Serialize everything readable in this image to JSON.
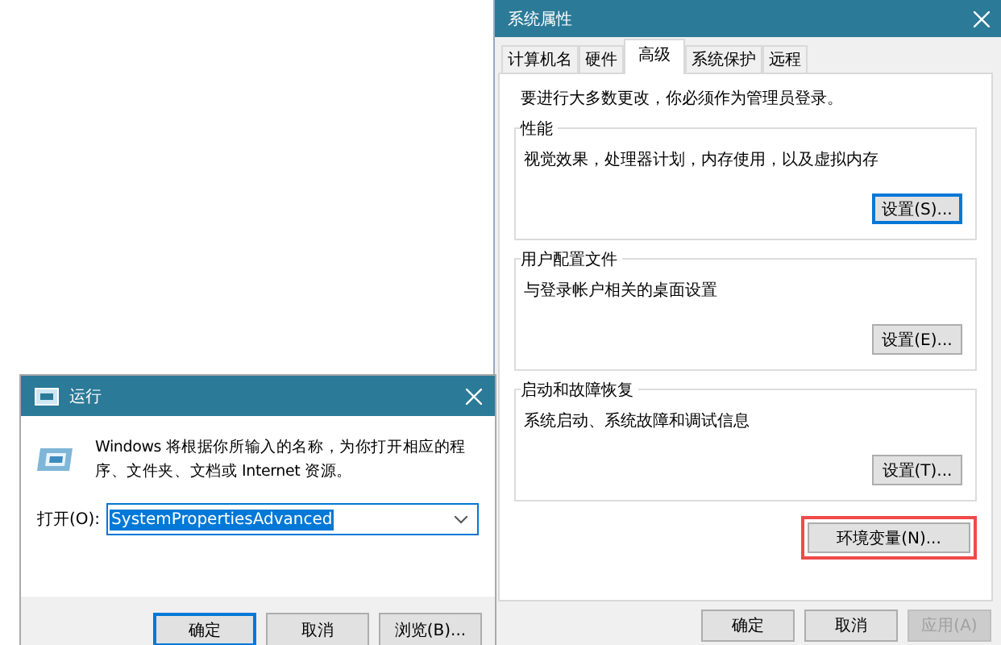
{
  "system_properties": {
    "title": "系统属性",
    "tabs": [
      {
        "label": "计算机名",
        "selected": false
      },
      {
        "label": "硬件",
        "selected": false
      },
      {
        "label": "高级",
        "selected": true
      },
      {
        "label": "系统保护",
        "selected": false
      },
      {
        "label": "远程",
        "selected": false
      }
    ],
    "admin_note": "要进行大多数更改，你必须作为管理员登录。",
    "groups": [
      {
        "title": "性能",
        "description": "视觉效果，处理器计划，内存使用，以及虚拟内存",
        "button": {
          "label": "设置(S)...",
          "default": true
        }
      },
      {
        "title": "用户配置文件",
        "description": "与登录帐户相关的桌面设置",
        "button": {
          "label": "设置(E)...",
          "default": false
        }
      },
      {
        "title": "启动和故障恢复",
        "description": "系统启动、系统故障和调试信息",
        "button": {
          "label": "设置(T)...",
          "default": false
        }
      }
    ],
    "environment_button": {
      "label": "环境变量(N)...",
      "highlighted": true
    },
    "buttons": [
      {
        "label": "确定",
        "disabled": false
      },
      {
        "label": "取消",
        "disabled": false
      },
      {
        "label": "应用(A)",
        "disabled": true
      }
    ]
  },
  "run_dialog": {
    "title": "运行",
    "description": "Windows 将根据你所输入的名称，为你打开相应的程序、文件夹、文档或 Internet 资源。",
    "open_label": "打开(O):",
    "command": {
      "value": "SystemPropertiesAdvanced",
      "value_selected": true
    },
    "buttons": [
      {
        "label": "确定",
        "default": true
      },
      {
        "label": "取消",
        "default": false
      },
      {
        "label": "浏览(B)...",
        "default": false
      }
    ]
  }
}
